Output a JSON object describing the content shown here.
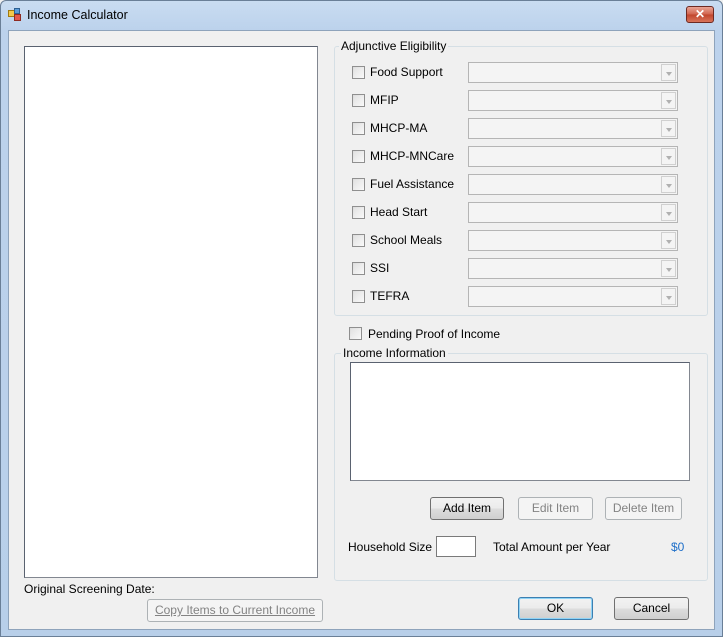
{
  "window": {
    "title": "Income Calculator",
    "close_glyph": "✕",
    "icon": "app-icon"
  },
  "left": {
    "original_screening_date_label": "Original Screening Date:",
    "copy_button": "Copy Items to Current Income"
  },
  "adjunctive": {
    "title": "Adjunctive Eligibility",
    "items": [
      {
        "label": "Food Support",
        "checked": false,
        "value": ""
      },
      {
        "label": "MFIP",
        "checked": false,
        "value": ""
      },
      {
        "label": "MHCP-MA",
        "checked": false,
        "value": ""
      },
      {
        "label": "MHCP-MNCare",
        "checked": false,
        "value": ""
      },
      {
        "label": "Fuel Assistance",
        "checked": false,
        "value": ""
      },
      {
        "label": "Head Start",
        "checked": false,
        "value": ""
      },
      {
        "label": "School Meals",
        "checked": false,
        "value": ""
      },
      {
        "label": "SSI",
        "checked": false,
        "value": ""
      },
      {
        "label": "TEFRA",
        "checked": false,
        "value": ""
      }
    ]
  },
  "pending": {
    "label": "Pending Proof of Income",
    "checked": false
  },
  "income": {
    "title": "Income Information",
    "add_button": "Add Item",
    "edit_button": "Edit Item",
    "delete_button": "Delete Item",
    "household_size_label": "Household Size",
    "household_size_value": "",
    "total_label": "Total Amount per Year",
    "total_value": "$0",
    "total_color": "#1e6fc9"
  },
  "footer": {
    "ok_button": "OK",
    "cancel_button": "Cancel"
  }
}
